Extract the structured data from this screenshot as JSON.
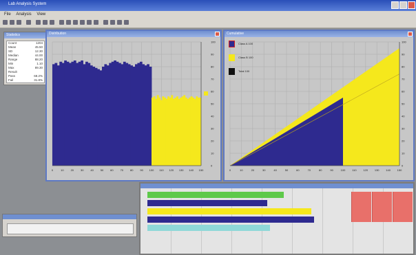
{
  "app": {
    "title": "Lab Analysis System",
    "menu": [
      "File",
      "Analysis",
      "View"
    ]
  },
  "stats": {
    "title": "Statistics",
    "rows": [
      {
        "k": "Count",
        "v": "1204"
      },
      {
        "k": "Mean",
        "v": "45.50"
      },
      {
        "k": "SD",
        "v": "12.30"
      },
      {
        "k": "Median",
        "v": "44.00"
      },
      {
        "k": "Range",
        "v": "88.20"
      },
      {
        "k": "Min",
        "v": "1.10"
      },
      {
        "k": "Max",
        "v": "89.30"
      },
      {
        "k": "Result",
        "v": ""
      },
      {
        "k": "Pass",
        "v": "68.2%"
      },
      {
        "k": "Fail",
        "v": "31.8%"
      }
    ]
  },
  "histogram": {
    "title": "Distribution",
    "xticks": [
      "0",
      "10",
      "20",
      "30",
      "40",
      "50",
      "60",
      "70",
      "80",
      "90",
      "100",
      "110",
      "120",
      "130",
      "140",
      "150"
    ],
    "yticks": [
      "0",
      "10",
      "20",
      "30",
      "40",
      "50",
      "60",
      "70",
      "80",
      "90",
      "100"
    ]
  },
  "cumulative": {
    "title": "Cumulative",
    "legend": [
      {
        "label": "Class A  100",
        "color": "#2e2a8f"
      },
      {
        "label": "Class B  100",
        "color": "#f5e81c"
      },
      {
        "label": "Total  100",
        "color": "#111111"
      }
    ],
    "xticks": [
      "0",
      "10",
      "20",
      "30",
      "40",
      "50",
      "60",
      "70",
      "80",
      "90",
      "100",
      "110",
      "120",
      "130",
      "140",
      "150"
    ],
    "yticks": [
      "0",
      "10",
      "20",
      "30",
      "40",
      "50",
      "60",
      "70",
      "80",
      "90",
      "100"
    ]
  },
  "chart_data": [
    {
      "type": "bar",
      "series": [
        {
          "name": "Class A",
          "color": "#2e2a8f",
          "values": [
            82,
            83,
            81,
            84,
            83,
            85,
            84,
            83,
            84,
            85,
            83,
            84,
            85,
            82,
            84,
            83,
            81,
            80,
            79,
            78,
            77,
            80,
            82,
            81,
            83,
            84,
            85,
            84,
            83,
            82,
            84,
            83,
            82,
            81,
            80,
            82,
            83,
            84,
            82,
            81,
            82,
            80
          ]
        },
        {
          "name": "Class B",
          "color": "#f5e81c",
          "values": [
            0,
            0,
            0,
            0,
            0,
            0,
            0,
            0,
            0,
            0,
            0,
            0,
            0,
            0,
            0,
            0,
            0,
            0,
            0,
            0,
            0,
            0,
            0,
            0,
            0,
            0,
            0,
            0,
            0,
            0,
            0,
            0,
            0,
            0,
            0,
            0,
            0,
            0,
            0,
            0,
            0,
            0,
            0,
            0,
            0,
            0,
            0,
            0,
            0,
            0,
            0,
            0,
            0,
            0,
            0,
            0,
            0,
            0,
            0,
            0,
            0,
            0,
            0,
            0,
            0,
            0,
            0,
            0,
            0,
            0,
            0,
            0,
            0,
            0,
            0,
            0,
            0,
            0,
            0,
            0
          ]
        }
      ],
      "x_range": [
        0,
        150
      ],
      "ylim": [
        0,
        100
      ],
      "split_x": 100,
      "class_a_level": 83,
      "class_b_level": 55,
      "grid": true
    },
    {
      "type": "area",
      "series": [
        {
          "name": "Class A",
          "color": "#2e2a8f",
          "values": [
            0,
            55
          ]
        },
        {
          "name": "Class B",
          "color": "#f5e81c",
          "values": [
            0,
            95
          ]
        }
      ],
      "x": [
        0,
        150
      ],
      "split_x": 100,
      "ylim": [
        0,
        100
      ],
      "grid": true
    }
  ],
  "bar_panel": {
    "bars": [
      {
        "name": "green",
        "color": "#5ec94a",
        "fraction": 0.5
      },
      {
        "name": "navy",
        "color": "#2e2a8f",
        "fraction": 0.44
      },
      {
        "name": "yellow",
        "color": "#f5e81c",
        "fraction": 0.6
      },
      {
        "name": "navy2",
        "color": "#2e2a8f",
        "fraction": 0.61
      },
      {
        "name": "cyan",
        "color": "#8fd8d8",
        "fraction": 0.45
      }
    ],
    "highlight_color": "#e8706a"
  }
}
